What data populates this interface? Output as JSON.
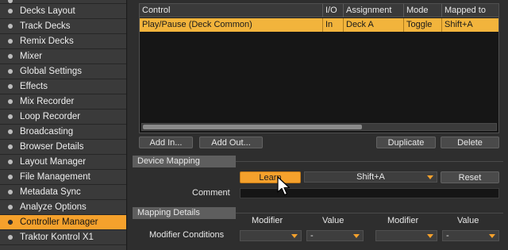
{
  "sidebar": {
    "items": [
      {
        "label": "Decks Layout"
      },
      {
        "label": "Track Decks"
      },
      {
        "label": "Remix Decks"
      },
      {
        "label": "Mixer"
      },
      {
        "label": "Global Settings"
      },
      {
        "label": "Effects"
      },
      {
        "label": "Mix Recorder"
      },
      {
        "label": "Loop Recorder"
      },
      {
        "label": "Broadcasting"
      },
      {
        "label": "Browser Details"
      },
      {
        "label": "Layout Manager"
      },
      {
        "label": "File Management"
      },
      {
        "label": "Metadata Sync"
      },
      {
        "label": "Analyze Options"
      },
      {
        "label": "Controller Manager",
        "selected": true
      },
      {
        "label": "Traktor Kontrol X1"
      }
    ]
  },
  "table": {
    "headers": [
      "Control",
      "I/O",
      "Assignment",
      "Mode",
      "Mapped to"
    ],
    "rows": [
      [
        "Play/Pause (Deck Common)",
        "In",
        "Deck A",
        "Toggle",
        "Shift+A"
      ]
    ]
  },
  "buttons": {
    "add_in": "Add In...",
    "add_out": "Add Out...",
    "duplicate": "Duplicate",
    "delete": "Delete",
    "learn": "Learn",
    "reset": "Reset"
  },
  "device_mapping": {
    "section_label": "Device Mapping",
    "mapped_value": "Shift+A",
    "comment_label": "Comment",
    "comment_value": ""
  },
  "mapping_details": {
    "section_label": "Mapping Details",
    "modifier_header_1": "Modifier",
    "value_header_1": "Value",
    "modifier_header_2": "Modifier",
    "value_header_2": "Value",
    "conditions_label": "Modifier Conditions",
    "cond1_modifier": "",
    "cond1_value": "-",
    "cond2_modifier": "",
    "cond2_value": "-"
  },
  "colors": {
    "accent": "#f5a12c",
    "selected_row": "#f2b43c"
  }
}
